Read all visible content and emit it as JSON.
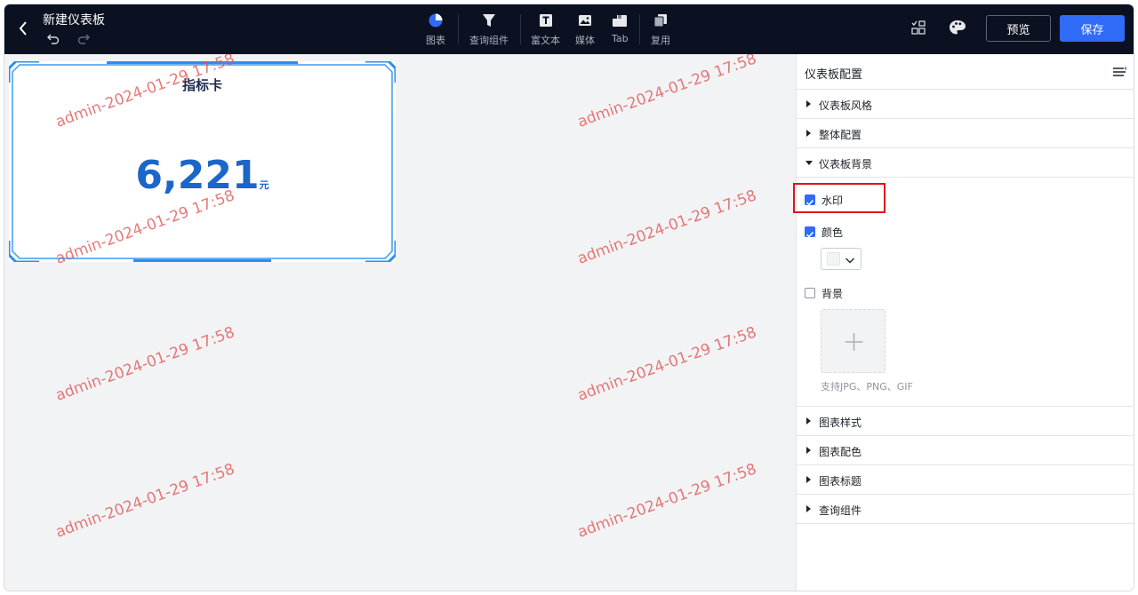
{
  "header": {
    "title": "新建仪表板",
    "toolbar": [
      {
        "label": "图表",
        "icon": "pie-chart-icon"
      },
      {
        "label": "查询组件",
        "icon": "filter-icon"
      },
      {
        "label": "富文本",
        "icon": "text-icon"
      },
      {
        "label": "媒体",
        "icon": "image-icon"
      },
      {
        "label": "Tab",
        "icon": "tab-icon"
      },
      {
        "label": "复用",
        "icon": "copy-icon"
      }
    ],
    "preview_label": "预览",
    "save_label": "保存"
  },
  "canvas": {
    "watermark": "admin-2024-01-29 17:58",
    "card": {
      "title": "指标卡",
      "value": "6,221",
      "unit": "元",
      "value_color": "#1b66c9"
    }
  },
  "panel": {
    "title": "仪表板配置",
    "sections_top": [
      "仪表板风格",
      "整体配置"
    ],
    "expanded_section": "仪表板背景",
    "options": {
      "watermark": {
        "label": "水印",
        "checked": true
      },
      "color": {
        "label": "颜色",
        "checked": true,
        "swatch": "#f3f4f6"
      },
      "background": {
        "label": "背景",
        "checked": false
      },
      "upload_hint": "支持JPG、PNG、GIF"
    },
    "sections_bottom": [
      "图表样式",
      "图表配色",
      "图表标题",
      "查询组件"
    ]
  },
  "colors": {
    "header_bg": "#0b1120",
    "accent": "#2f6bf6",
    "highlight": "#e0101a",
    "watermark": "#e25353"
  }
}
